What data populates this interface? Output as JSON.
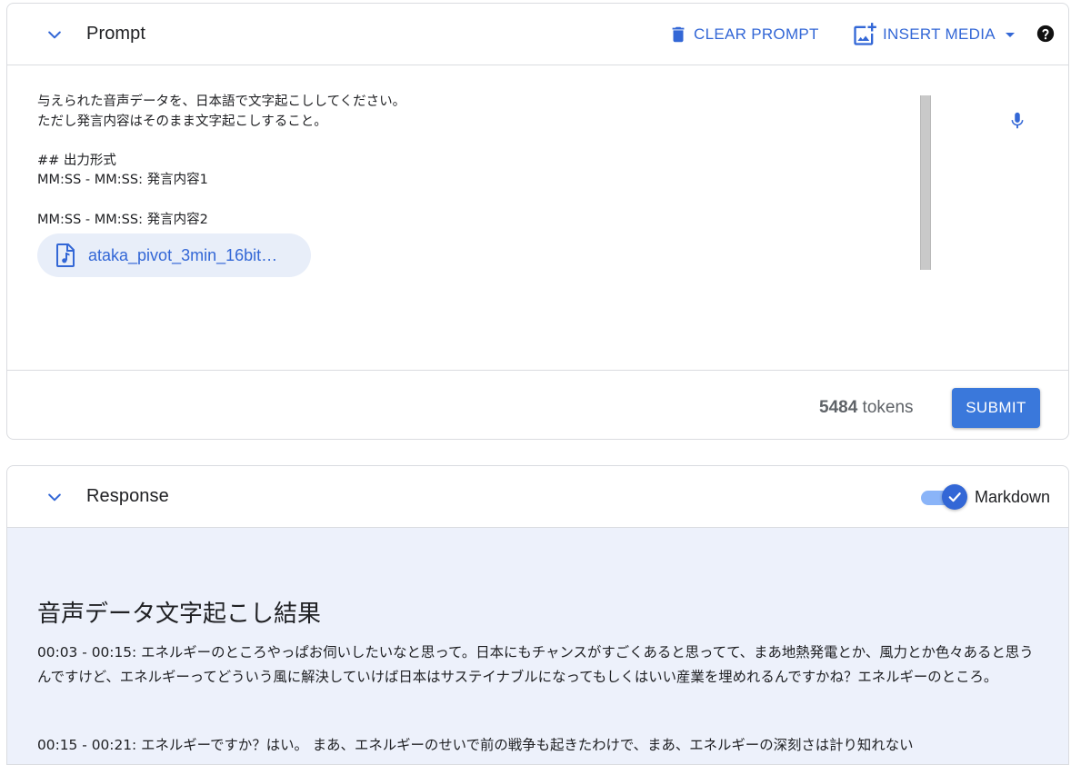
{
  "prompt_panel": {
    "title": "Prompt",
    "clear_label": "CLEAR PROMPT",
    "insert_media_label": "INSERT MEDIA",
    "text": "与えられた音声データを、日本語で文字起こししてください。\nただし発言内容はそのまま文字起こしすること。\n\n## 出力形式\nMM:SS - MM:SS: 発言内容1\n\nMM:SS - MM:SS: 発言内容2",
    "attachment": {
      "name": "ataka_pivot_3min_16bit…"
    },
    "token_count": "5484",
    "token_unit": " tokens",
    "submit_label": "SUBMIT"
  },
  "response_panel": {
    "title": "Response",
    "markdown_label": "Markdown",
    "markdown_enabled": true,
    "heading": "音声データ文字起こし結果",
    "paragraphs": [
      "00:03 - 00:15: エネルギーのところやっぱお伺いしたいなと思って。日本にもチャンスがすごくあると思ってて、まあ地熱発電とか、風力とか色々あると思うんですけど、エネルギーってどういう風に解決していけば日本はサステイナブルになってもしくはいい産業を埋めれるんですかね？エネルギーのところ。",
      "00:15 - 00:21: エネルギーですか？はい。 まあ、エネルギーのせいで前の戦争も起きたわけで、まあ、エネルギーの深刻さは計り知れない"
    ]
  },
  "colors": {
    "accent": "#3367d6",
    "submit_bg": "#3a78db",
    "response_bg": "#edf1fb",
    "chip_bg": "#e8eef9",
    "toggle_track": "#8ab4f8"
  },
  "icons": {
    "collapse": "chevron-down-icon",
    "clear": "trash-icon",
    "insert_media": "add-photo-icon",
    "dropdown": "caret-down-icon",
    "help": "help-icon",
    "mic": "mic-icon",
    "audio_file": "audio-file-icon",
    "check": "check-icon"
  }
}
